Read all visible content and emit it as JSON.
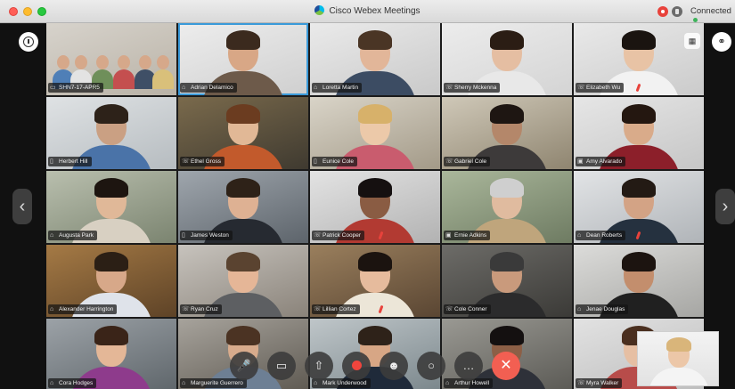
{
  "window": {
    "title": "Cisco Webex Meetings",
    "status": "Connected"
  },
  "controls": {
    "more_label": "…",
    "end_label": "✕"
  },
  "participants": [
    {
      "name": "SHN7-17-APR5",
      "icon": "room-device-icon",
      "glyph": "▭",
      "kind": "group",
      "bg1": "#d7d3cc",
      "bg2": "#b9b2a6"
    },
    {
      "name": "Adrian Delamico",
      "icon": "headset-icon",
      "glyph": "⌂",
      "bg1": "#ededed",
      "bg2": "#cfcfcf",
      "skin": "#d8a786",
      "hair": "#3b2a1e",
      "shirt": "#6d5a4a",
      "active": true
    },
    {
      "name": "Loretta Martin",
      "icon": "headset-icon",
      "glyph": "⌂",
      "bg1": "#eaeaea",
      "bg2": "#c9c9c9",
      "skin": "#e2b699",
      "hair": "#4a3525",
      "shirt": "#3c4c63"
    },
    {
      "name": "Sherry Mckenna",
      "icon": "phone-icon",
      "glyph": "☏",
      "bg1": "#ececec",
      "bg2": "#d4d4d4",
      "skin": "#e5bea2",
      "hair": "#2b1d14",
      "shirt": "#e8e8e8"
    },
    {
      "name": "Elizabeth Wu",
      "icon": "phone-icon",
      "glyph": "☏",
      "bg1": "#e9e9e9",
      "bg2": "#cbcbcb",
      "skin": "#e8c3a5",
      "hair": "#1a1410",
      "shirt": "#f2f2f2",
      "muted": true
    },
    {
      "name": "Herbert Hill",
      "icon": "mobile-icon",
      "glyph": "▯",
      "bg1": "#dfe2e4",
      "bg2": "#b6bcc0",
      "skin": "#caa083",
      "hair": "#2d2219",
      "shirt": "#4a73a8"
    },
    {
      "name": "Ethel Gross",
      "icon": "phone-icon",
      "glyph": "☏",
      "bg1": "#7a6a4c",
      "bg2": "#3f3a30",
      "skin": "#e1b896",
      "hair": "#6b3c20",
      "shirt": "#c25a2c"
    },
    {
      "name": "Eunice Cole",
      "icon": "mobile-icon",
      "glyph": "▯",
      "bg1": "#d9d4c8",
      "bg2": "#a39a88",
      "skin": "#ecc9a9",
      "hair": "#d7b16a",
      "shirt": "#c95c6e"
    },
    {
      "name": "Gabriel Cole",
      "icon": "phone-icon",
      "glyph": "☏",
      "bg1": "#cfc8b8",
      "bg2": "#8f8570",
      "skin": "#b4876a",
      "hair": "#1e1612",
      "shirt": "#3d3a3a"
    },
    {
      "name": "Amy Alvarado",
      "icon": "video-device-icon",
      "glyph": "▣",
      "bg1": "#e6e6e6",
      "bg2": "#c6c6c6",
      "skin": "#d9ab8a",
      "hair": "#241710",
      "shirt": "#8c1f2a"
    },
    {
      "name": "Augusta Park",
      "icon": "headset-icon",
      "glyph": "⌂",
      "bg1": "#b9bfae",
      "bg2": "#7b8470",
      "skin": "#e0b898",
      "hair": "#1d1510",
      "shirt": "#d8d0c2"
    },
    {
      "name": "James Weston",
      "icon": "mobile-icon",
      "glyph": "▯",
      "bg1": "#9fa6ad",
      "bg2": "#5d646b",
      "skin": "#deb193",
      "hair": "#2e2218",
      "shirt": "#262a31"
    },
    {
      "name": "Patrick Cooper",
      "icon": "phone-icon",
      "glyph": "☏",
      "bg1": "#e3e3e3",
      "bg2": "#b2b2b2",
      "skin": "#8a5c43",
      "hair": "#151010",
      "shirt": "#b23a32",
      "muted": true
    },
    {
      "name": "Ernie Adkins",
      "icon": "video-device-icon",
      "glyph": "▣",
      "bg1": "#aab79b",
      "bg2": "#6e7b62",
      "skin": "#e0bb9f",
      "hair": "#cfcfcf",
      "shirt": "#bfa57c"
    },
    {
      "name": "Dean Roberts",
      "icon": "headset-icon",
      "glyph": "⌂",
      "bg1": "#e2e4e6",
      "bg2": "#b0b4b8",
      "skin": "#d3a385",
      "hair": "#231a14",
      "shirt": "#25313f",
      "muted": true
    },
    {
      "name": "Alexander Harrington",
      "icon": "headset-icon",
      "glyph": "⌂",
      "bg1": "#a57a45",
      "bg2": "#5e4327",
      "skin": "#d7a889",
      "hair": "#2b1f15",
      "shirt": "#dfe3ea"
    },
    {
      "name": "Ryan Cruz",
      "icon": "phone-icon",
      "glyph": "☏",
      "bg1": "#c7c3bd",
      "bg2": "#8a837a",
      "skin": "#e5b697",
      "hair": "#5a4330",
      "shirt": "#5d5f62"
    },
    {
      "name": "Lillian Cortez",
      "icon": "phone-icon",
      "glyph": "☏",
      "bg1": "#9a7f5d",
      "bg2": "#5a4633",
      "skin": "#e6bb9d",
      "hair": "#1b130f",
      "shirt": "#ece6d8",
      "muted": true
    },
    {
      "name": "Cole Conner",
      "icon": "phone-icon",
      "glyph": "☏",
      "bg1": "#6d6c68",
      "bg2": "#3b3a37",
      "skin": "#c99a7c",
      "hair": "#3a3a3a",
      "shirt": "#2b2b2c"
    },
    {
      "name": "Jenae Douglas",
      "icon": "headset-icon",
      "glyph": "⌂",
      "bg1": "#dcdcda",
      "bg2": "#a6a6a3",
      "skin": "#c38e6d",
      "hair": "#1c1410",
      "shirt": "#202020"
    },
    {
      "name": "Cora Hodges",
      "icon": "headset-icon",
      "glyph": "⌂",
      "bg1": "#9ca2a7",
      "bg2": "#5f666b",
      "skin": "#e4b797",
      "hair": "#3a2418",
      "shirt": "#8e3b8c"
    },
    {
      "name": "Marguerite Guerrero",
      "icon": "headset-icon",
      "glyph": "⌂",
      "bg1": "#a7a39c",
      "bg2": "#5f5a52",
      "skin": "#d8ab8c",
      "hair": "#4b3323",
      "shirt": "#6d7f94"
    },
    {
      "name": "Mark Underwood",
      "icon": "headset-icon",
      "glyph": "⌂",
      "bg1": "#bfc6c9",
      "bg2": "#7b878c",
      "skin": "#d7a685",
      "hair": "#2e2219",
      "shirt": "#1f2a3a"
    },
    {
      "name": "Arthur Howell",
      "icon": "headset-icon",
      "glyph": "⌂",
      "bg1": "#9a9993",
      "bg2": "#5b5a55",
      "skin": "#8c5f46",
      "hair": "#141010",
      "shirt": "#2e3139"
    },
    {
      "name": "Myra Walker",
      "icon": "phone-icon",
      "glyph": "☏",
      "bg1": "#e2e2e2",
      "bg2": "#bdbdbd",
      "skin": "#e6bfa3",
      "hair": "#4a2f1f",
      "shirt": "#b84c4a"
    }
  ],
  "self_view": {
    "skin": "#ecc7a8",
    "hair": "#d9b57a",
    "shirt": "#f4f4f4"
  }
}
